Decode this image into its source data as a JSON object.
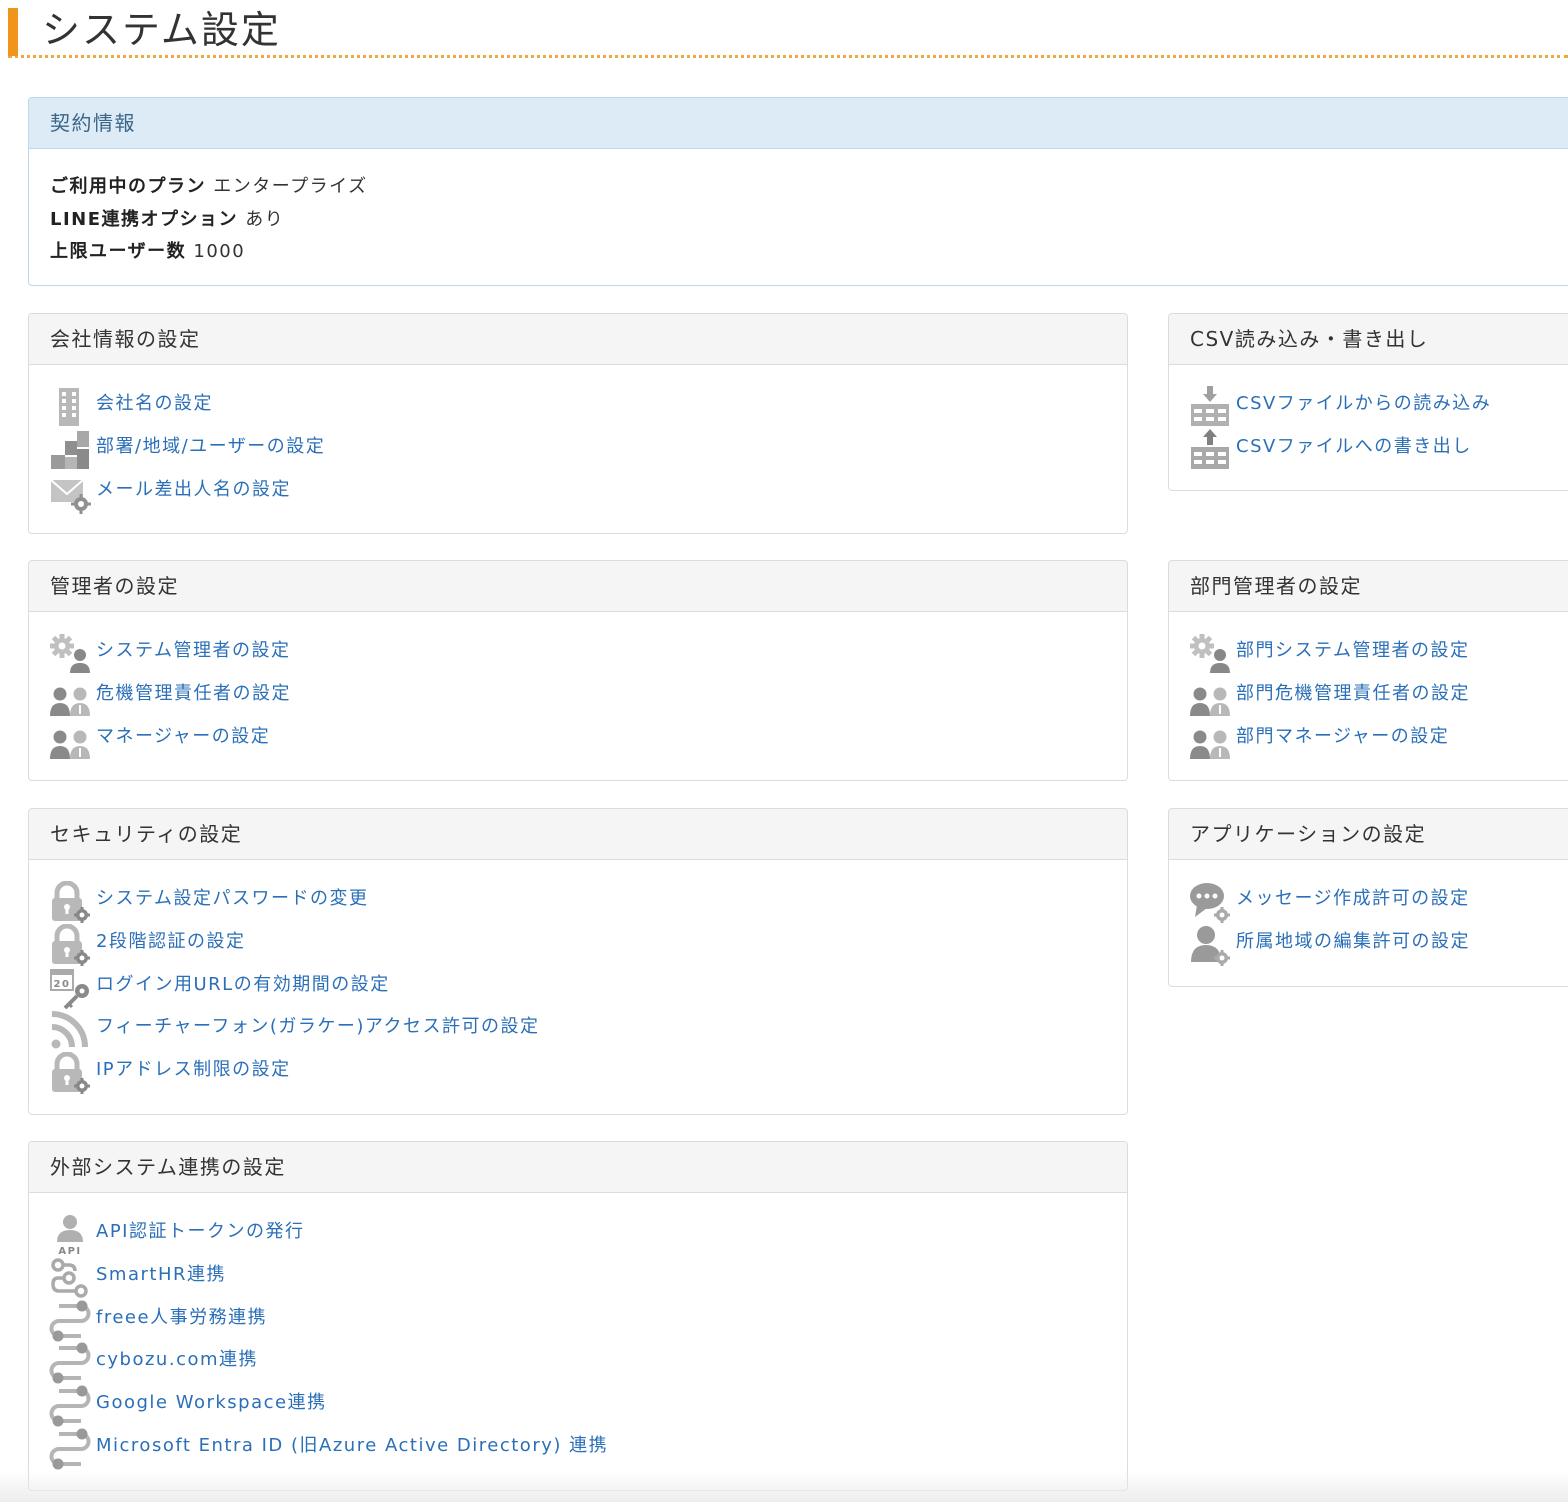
{
  "page": {
    "title": "システム設定"
  },
  "contract": {
    "heading": "契約情報",
    "rows": [
      {
        "label": "ご利用中のプラン",
        "value": "エンタープライズ"
      },
      {
        "label": "LINE連携オプション",
        "value": "あり"
      },
      {
        "label": "上限ユーザー数",
        "value": "1000"
      }
    ]
  },
  "company": {
    "heading": "会社情報の設定",
    "items": [
      {
        "label": "会社名の設定",
        "icon": "building-icon"
      },
      {
        "label": "部署/地域/ユーザーの設定",
        "icon": "org-blocks-icon"
      },
      {
        "label": "メール差出人名の設定",
        "icon": "mail-gear-icon"
      }
    ]
  },
  "csv": {
    "heading": "CSV読み込み・書き出し",
    "items": [
      {
        "label": "CSVファイルからの読み込み",
        "icon": "csv-import-icon"
      },
      {
        "label": "CSVファイルへの書き出し",
        "icon": "csv-export-icon"
      }
    ]
  },
  "admin": {
    "heading": "管理者の設定",
    "items": [
      {
        "label": "システム管理者の設定",
        "icon": "gear-user-icon"
      },
      {
        "label": "危機管理責任者の設定",
        "icon": "users-icon"
      },
      {
        "label": "マネージャーの設定",
        "icon": "users-icon"
      }
    ]
  },
  "dept": {
    "heading": "部門管理者の設定",
    "items": [
      {
        "label": "部門システム管理者の設定",
        "icon": "gear-user-icon"
      },
      {
        "label": "部門危機管理責任者の設定",
        "icon": "users-icon"
      },
      {
        "label": "部門マネージャーの設定",
        "icon": "users-icon"
      }
    ]
  },
  "security": {
    "heading": "セキュリティの設定",
    "items": [
      {
        "label": "システム設定パスワードの変更",
        "icon": "lock-gear-icon"
      },
      {
        "label": "2段階認証の設定",
        "icon": "lock-gear-icon"
      },
      {
        "label": "ログイン用URLの有効期間の設定",
        "icon": "calendar-key-icon",
        "calendar_day": "20"
      },
      {
        "label": "フィーチャーフォン(ガラケー)アクセス許可の設定",
        "icon": "rss-icon"
      },
      {
        "label": "IPアドレス制限の設定",
        "icon": "lock-gear-icon"
      }
    ]
  },
  "app": {
    "heading": "アプリケーションの設定",
    "items": [
      {
        "label": "メッセージ作成許可の設定",
        "icon": "chat-gear-icon"
      },
      {
        "label": "所属地域の編集許可の設定",
        "icon": "user-gear-icon"
      }
    ]
  },
  "external": {
    "heading": "外部システム連携の設定",
    "items": [
      {
        "label": "API認証トークンの発行",
        "icon": "api-user-icon",
        "icon_text": "API"
      },
      {
        "label": "SmartHR連携",
        "icon": "link-nodes-icon"
      },
      {
        "label": "freee人事労務連携",
        "icon": "pipeline-icon"
      },
      {
        "label": "cybozu.com連携",
        "icon": "pipeline-icon"
      },
      {
        "label": "Google Workspace連携",
        "icon": "pipeline-icon"
      },
      {
        "label": "Microsoft Entra ID (旧Azure Active Directory) 連携",
        "icon": "pipeline-icon"
      }
    ]
  },
  "colors": {
    "accent": "#f0941c",
    "link": "#2a6fb8",
    "icon_gray": "#b3b3b3",
    "info_header_bg": "#dcebf6"
  }
}
